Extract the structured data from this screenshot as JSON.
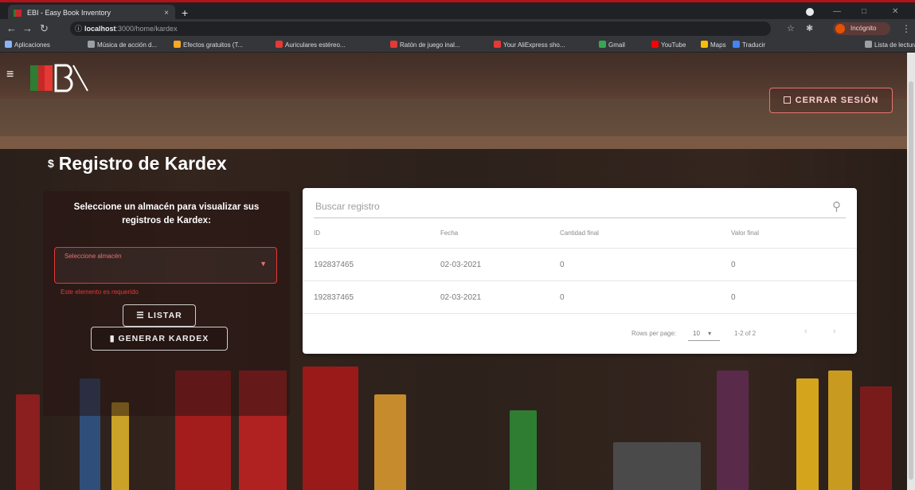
{
  "browser": {
    "tab_title": "EBI - Easy Book Inventory",
    "tab_close": "×",
    "new_tab": "+",
    "url_host": "localhost",
    "url_path": ":3000/home/kardex",
    "incognito_label": "Incógnito",
    "bookmarks": [
      {
        "label": "Aplicaciones",
        "color": "#8ab4f8"
      },
      {
        "label": "Música de acción d...",
        "color": "#9aa0a6"
      },
      {
        "label": "Efectos gratuitos (T...",
        "color": "#f9a825"
      },
      {
        "label": "Auriculares estéreo...",
        "color": "#e53935"
      },
      {
        "label": "Ratón de juego inal...",
        "color": "#e53935"
      },
      {
        "label": "Your AliExpress sho...",
        "color": "#e53935"
      },
      {
        "label": "Gmail",
        "color": "#34a853"
      },
      {
        "label": "YouTube",
        "color": "#ff0000"
      },
      {
        "label": "Maps",
        "color": "#fbbc04"
      },
      {
        "label": "Traducir",
        "color": "#4285f4"
      },
      {
        "label": "Lista de lectura",
        "color": "#9aa0a6"
      }
    ]
  },
  "appbar": {
    "logout_label": "CERRAR SESIÓN"
  },
  "page": {
    "title_icon": "$",
    "title": "Registro de Kardex"
  },
  "left_panel": {
    "prompt": "Seleccione un almacén para visualizar sus registros de Kardex:",
    "select_label": "Seleccione almacén",
    "select_value": "",
    "helper_text": "Este elemento es requerido",
    "listar_label": "LISTAR",
    "generar_label": "GENERAR KARDEX"
  },
  "table": {
    "search_placeholder": "Buscar registro",
    "columns": [
      "ID",
      "Fecha",
      "Cantidad final",
      "Valor final"
    ],
    "rows": [
      [
        "192837465",
        "02-03-2021",
        "0",
        "0"
      ],
      [
        "192837465",
        "02-03-2021",
        "0",
        "0"
      ]
    ],
    "rows_per_page_label": "Rows per page:",
    "rows_per_page_value": "10",
    "range_label": "1-2 of 2"
  },
  "colors": {
    "accent_red": "#e53935",
    "card_bg": "#ffffff"
  },
  "icons": {
    "menu": "hamburger-menu-icon",
    "search": "search-icon",
    "logout": "logout-icon",
    "list": "list-icon",
    "document": "document-icon"
  }
}
